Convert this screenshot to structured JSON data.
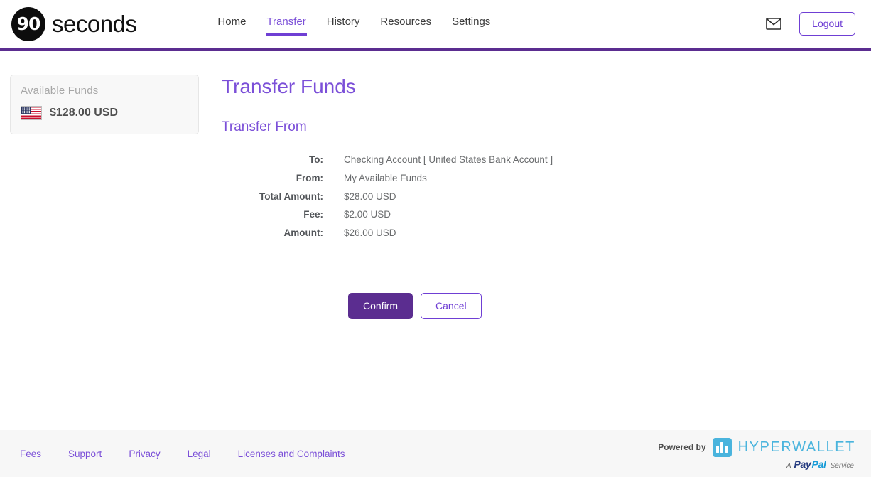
{
  "brand": {
    "mark_text": "90",
    "name": "seconds"
  },
  "nav": {
    "items": [
      {
        "label": "Home",
        "active": false
      },
      {
        "label": "Transfer",
        "active": true
      },
      {
        "label": "History",
        "active": false
      },
      {
        "label": "Resources",
        "active": false
      },
      {
        "label": "Settings",
        "active": false
      }
    ]
  },
  "header": {
    "mail_icon": "mail-icon",
    "logout_label": "Logout"
  },
  "sidebar": {
    "card": {
      "title": "Available Funds",
      "flag_icon": "us-flag-icon",
      "amount": "$128.00 USD"
    }
  },
  "main": {
    "page_title": "Transfer Funds",
    "section_title": "Transfer From",
    "details": [
      {
        "label": "To:",
        "value": "Checking Account [ United States Bank Account ]"
      },
      {
        "label": "From:",
        "value": "My Available Funds"
      },
      {
        "label": "Total Amount:",
        "value": "$28.00 USD"
      },
      {
        "label": "Fee:",
        "value": "$2.00 USD"
      },
      {
        "label": "Amount:",
        "value": "$26.00 USD"
      }
    ],
    "confirm_label": "Confirm",
    "cancel_label": "Cancel"
  },
  "footer": {
    "links": [
      {
        "label": "Fees"
      },
      {
        "label": "Support"
      },
      {
        "label": "Privacy"
      },
      {
        "label": "Legal"
      },
      {
        "label": "Licenses and Complaints"
      }
    ],
    "powered_by_label": "Powered by",
    "provider_name": "HYPERWALLET",
    "paypal_prefix": "A",
    "paypal_pay": "Pay",
    "paypal_pal": "Pal",
    "paypal_suffix": "Service"
  },
  "colors": {
    "accent_purple": "#5b2d90",
    "link_purple": "#7b4fd8",
    "hyperwallet_blue": "#4ab4dd",
    "paypal_dark_blue": "#253b80",
    "paypal_light_blue": "#179bd7"
  }
}
